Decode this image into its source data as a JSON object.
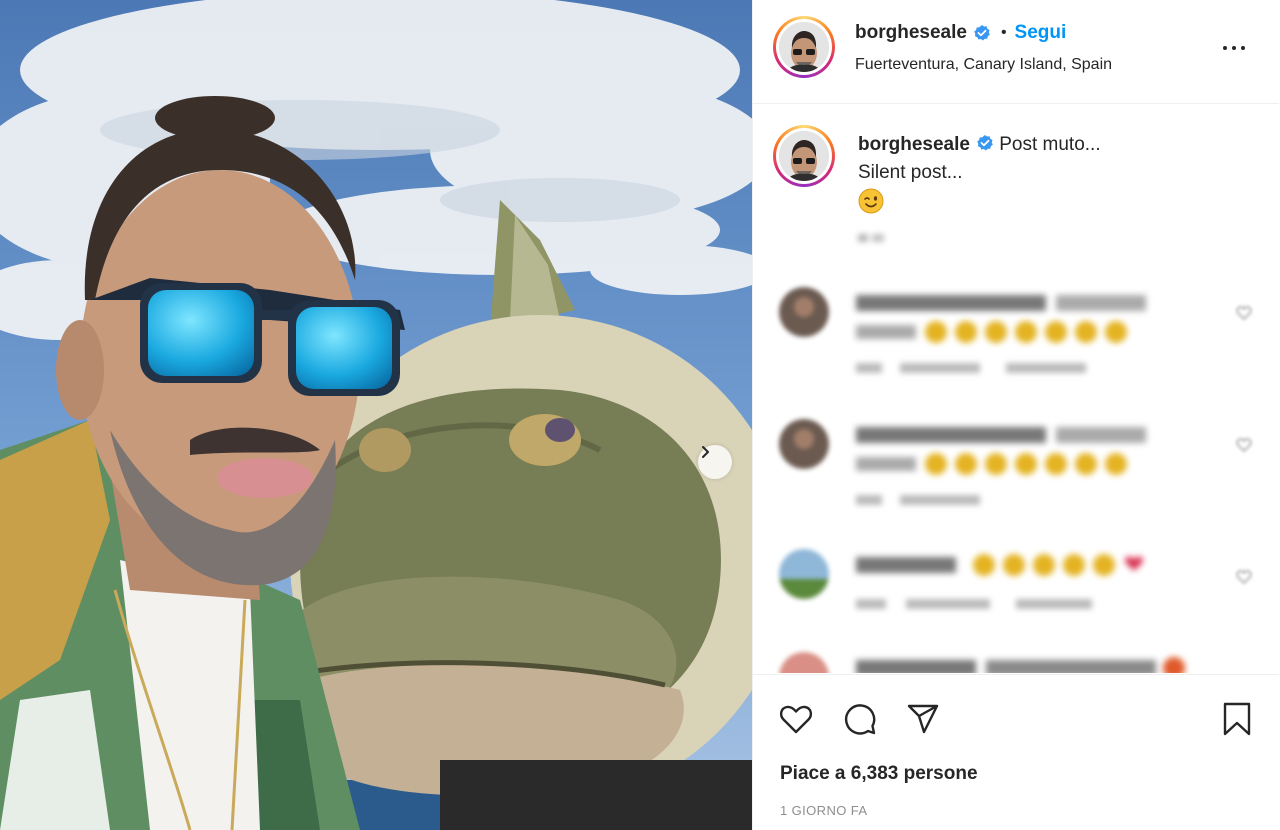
{
  "header": {
    "username": "borgheseale",
    "follow_label": "Segui",
    "location": "Fuerteventura, Canary Island, Spain"
  },
  "caption": {
    "username": "borgheseale",
    "line1": "Post muto...",
    "line2": "Silent post..."
  },
  "actions": {
    "likes_text": "Piace a 6,383 persone",
    "timestamp": "1 GIORNO FA"
  },
  "icons": {
    "more": "more-options-icon",
    "verified": "verified-badge-icon",
    "like": "heart-icon",
    "comment": "comment-icon",
    "share": "share-icon",
    "save": "bookmark-icon",
    "carousel": "chevron-right-icon"
  },
  "colors": {
    "accent": "#0095f6",
    "text": "#262626",
    "muted": "#8e8e8e",
    "border": "#efefef"
  }
}
